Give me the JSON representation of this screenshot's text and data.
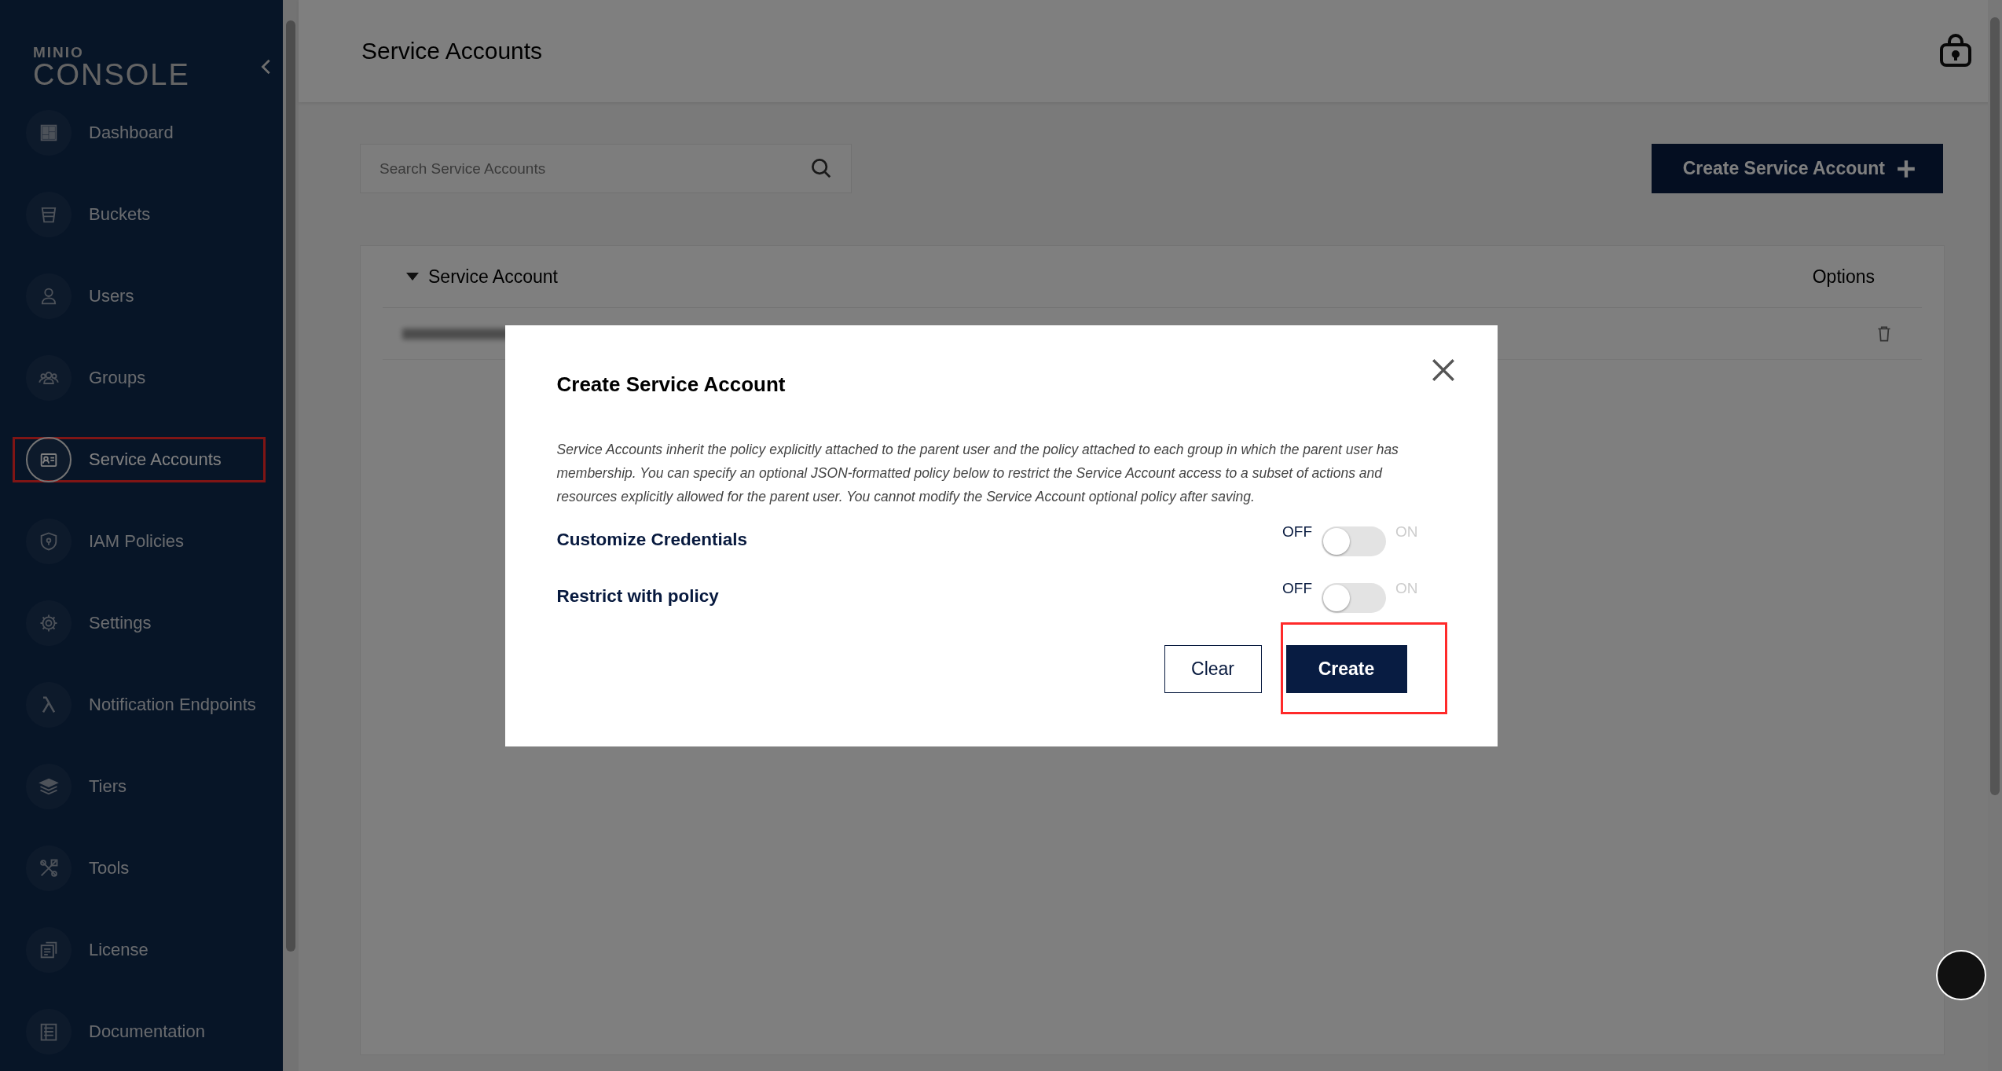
{
  "sidebar": {
    "logo_top": "MINIO",
    "logo_bottom": "CONSOLE",
    "items": [
      {
        "label": "Dashboard",
        "selected": false,
        "highlighted": false
      },
      {
        "label": "Buckets",
        "selected": false,
        "highlighted": false
      },
      {
        "label": "Users",
        "selected": false,
        "highlighted": false
      },
      {
        "label": "Groups",
        "selected": false,
        "highlighted": false
      },
      {
        "label": "Service Accounts",
        "selected": true,
        "highlighted": true
      },
      {
        "label": "IAM Policies",
        "selected": false,
        "highlighted": false
      },
      {
        "label": "Settings",
        "selected": false,
        "highlighted": false
      },
      {
        "label": "Notification Endpoints",
        "selected": false,
        "highlighted": false
      },
      {
        "label": "Tiers",
        "selected": false,
        "highlighted": false
      },
      {
        "label": "Tools",
        "selected": false,
        "highlighted": false
      },
      {
        "label": "License",
        "selected": false,
        "highlighted": false
      },
      {
        "label": "Documentation",
        "selected": false,
        "highlighted": false
      }
    ]
  },
  "header": {
    "title": "Service Accounts"
  },
  "search": {
    "placeholder": "Search Service Accounts"
  },
  "create_button": "Create Service Account",
  "table": {
    "columns": [
      "Service Account",
      "Options"
    ]
  },
  "modal": {
    "title": "Create Service Account",
    "description": "Service Accounts inherit the policy explicitly attached to the parent user and the policy attached to each group in which the parent user has membership. You can specify an optional JSON-formatted policy below to restrict the Service Account access to a subset of actions and resources explicitly allowed for the parent user. You cannot modify the Service Account optional policy after saving.",
    "toggles": [
      {
        "label": "Customize Credentials",
        "off_label": "OFF",
        "on_label": "ON",
        "on": false
      },
      {
        "label": "Restrict with policy",
        "off_label": "OFF",
        "on_label": "ON",
        "on": false
      }
    ],
    "buttons": [
      {
        "label": "Clear",
        "kind": "secondary",
        "highlighted": false
      },
      {
        "label": "Create",
        "kind": "primary",
        "highlighted": true
      }
    ]
  }
}
